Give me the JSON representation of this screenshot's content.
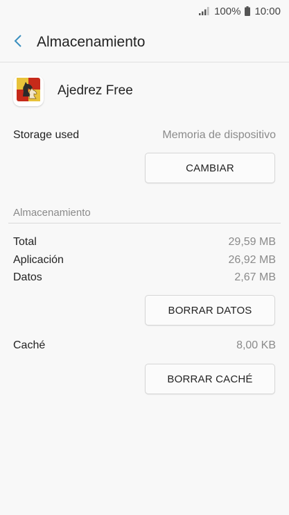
{
  "status_bar": {
    "battery": "100%",
    "time": "10:00"
  },
  "app_bar": {
    "title": "Almacenamiento"
  },
  "app": {
    "name": "Ajedrez Free"
  },
  "storage_used": {
    "label": "Storage used",
    "value": "Memoria de dispositivo",
    "button": "CAMBIAR"
  },
  "section": {
    "title": "Almacenamiento"
  },
  "storage": {
    "total_label": "Total",
    "total_value": "29,59 MB",
    "app_label": "Aplicación",
    "app_value": "26,92 MB",
    "data_label": "Datos",
    "data_value": "2,67 MB",
    "clear_data_button": "BORRAR DATOS"
  },
  "cache": {
    "label": "Caché",
    "value": "8,00 KB",
    "clear_cache_button": "BORRAR CACHÉ"
  },
  "colors": {
    "background": "#f8f8f8",
    "accent": "#3a8fbf",
    "secondary_text": "#8a8a8a"
  },
  "icons": {
    "back": "chevron-left-icon",
    "signal": "signal-icon",
    "battery": "battery-icon",
    "app": "chess-knight-icon"
  }
}
